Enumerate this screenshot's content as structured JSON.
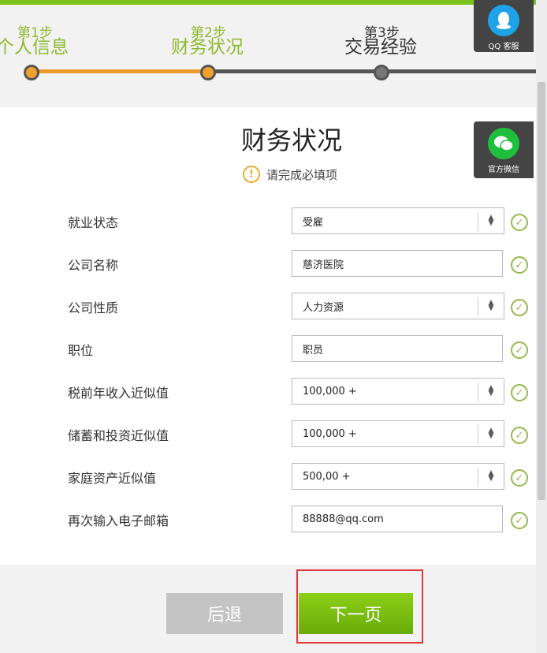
{
  "steps": [
    {
      "num": "第1步",
      "title": "个人信息",
      "state": "done"
    },
    {
      "num": "第2步",
      "title": "财务状况",
      "state": "done"
    },
    {
      "num": "第3步",
      "title": "交易经验",
      "state": "current"
    }
  ],
  "widgets": {
    "qq_label": "QQ 客服",
    "wechat_label": "官方微信"
  },
  "form": {
    "title": "财务状况",
    "notice": "请完成必填项",
    "fields": [
      {
        "label": "就业状态",
        "value": "受雇",
        "type": "select"
      },
      {
        "label": "公司名称",
        "value": "慈济医院",
        "type": "text"
      },
      {
        "label": "公司性质",
        "value": "人力资源",
        "type": "select"
      },
      {
        "label": "职位",
        "value": "职员",
        "type": "text"
      },
      {
        "label": "税前年收入近似值",
        "value": "100,000 +",
        "type": "select"
      },
      {
        "label": "储蓄和投资近似值",
        "value": "100,000 +",
        "type": "select"
      },
      {
        "label": "家庭资产近似值",
        "value": "500,00 +",
        "type": "select"
      },
      {
        "label": "再次输入电子邮箱",
        "value": "88888@qq.com",
        "type": "text"
      }
    ]
  },
  "buttons": {
    "back": "后退",
    "next": "下一页"
  },
  "colors": {
    "accent_green": "#7cc21a",
    "step_done": "#8fba2e",
    "progress_orange": "#f2a12e",
    "highlight_red": "#e0373c"
  }
}
